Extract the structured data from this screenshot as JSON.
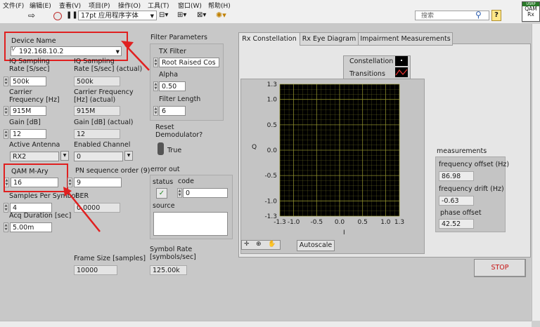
{
  "menu": [
    "文件(F)",
    "编辑(E)",
    "查看(V)",
    "项目(P)",
    "操作(O)",
    "工具(T)",
    "窗口(W)",
    "帮助(H)"
  ],
  "toolbar": {
    "font_select": "17pt 应用程序字体",
    "search_placeholder": "搜索",
    "help_label": "?",
    "vi_icon_top": "USRP",
    "vi_icon_label": "QAM\nRx"
  },
  "left": {
    "device_name_label": "Device Name",
    "device_name_value": "192.168.10.2",
    "iq_rate_label": "IQ Sampling\nRate [S/sec]",
    "iq_rate_value": "500k",
    "iq_rate_actual_label": "IQ Sampling\nRate [S/sec] (actual)",
    "iq_rate_actual_value": "500k",
    "carrier_label": "Carrier\nFrequency [Hz]",
    "carrier_value": "915M",
    "carrier_actual_label": "Carrier Frequency\n[Hz] (actual)",
    "carrier_actual_value": "915M",
    "gain_label": "Gain [dB]",
    "gain_value": "12",
    "gain_actual_label": "Gain [dB] (actual)",
    "gain_actual_value": "12",
    "antenna_label": "Active Antenna",
    "antenna_value": "RX2",
    "enabled_channel_label": "Enabled Channel",
    "enabled_channel_value": "0",
    "qam_label": "QAM M-Ary",
    "qam_value": "16",
    "pn_label": "PN sequence order (9)",
    "pn_value": "9",
    "sps_label": "Samples Per Symbol",
    "sps_value": "4",
    "ber_label": "BER",
    "ber_value": "0.0000",
    "acq_label": "Acq Duration [sec]",
    "acq_value": "5.00m",
    "frame_size_label": "Frame Size [samples]",
    "frame_size_value": "10000"
  },
  "filter": {
    "title": "Filter Parameters",
    "tx_filter_label": "TX Filter",
    "tx_filter_value": "Root Raised Cos",
    "alpha_label": "Alpha",
    "alpha_value": "0.50",
    "length_label": "Filter Length",
    "length_value": "6"
  },
  "reset": {
    "label": "Reset\nDemodulator?",
    "value": "True"
  },
  "error_out": {
    "title": "error out",
    "status_label": "status",
    "code_label": "code",
    "code_value": "0",
    "source_label": "source",
    "status_check": "✓"
  },
  "symbol_rate": {
    "label": "Symbol Rate\n[symbols/sec]",
    "value": "125.00k"
  },
  "tabs": [
    "Rx Constellation",
    "Rx Eye Diagram",
    "Impairment Measurements"
  ],
  "graph": {
    "legend": [
      "Constellation",
      "Transitions"
    ],
    "ylabel": "Q",
    "xlabel": "I",
    "autoscale": "Autoscale",
    "plot_bg": "#000000",
    "grid_color": "#9a9a30"
  },
  "chart_data": {
    "type": "scatter",
    "title": "",
    "xlabel": "I",
    "ylabel": "Q",
    "xlim": [
      -1.3,
      1.3
    ],
    "ylim": [
      -1.3,
      1.3
    ],
    "xticks": [
      "-1.3",
      "-1.0",
      "-0.5",
      "0.0",
      "0.5",
      "1.0",
      "1.3"
    ],
    "yticks": [
      "1.3",
      "1.0",
      "0.5",
      "0.0",
      "-0.5",
      "-1.0",
      "-1.3"
    ],
    "series": [
      {
        "name": "Constellation",
        "values": []
      }
    ],
    "grid": true,
    "legend": "top-right"
  },
  "measurements": {
    "title": "measurements",
    "freq_offset_label": "frequency offset (Hz)",
    "freq_offset_value": "86.98",
    "freq_drift_label": "frequency drift (Hz)",
    "freq_drift_value": "-0.63",
    "phase_offset_label": "phase offset",
    "phase_offset_value": "42.52"
  },
  "stop_label": "STOP",
  "colors": {
    "highlight": "#e02020",
    "stop_text": "#c81414"
  }
}
